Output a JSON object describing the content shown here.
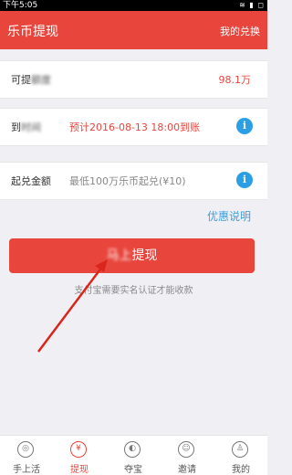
{
  "statusbar": {
    "time": "下午5:05",
    "icons": "≋ ▮ ◻"
  },
  "header": {
    "title": "乐币提现",
    "right_link": "我的兑换"
  },
  "rows": {
    "available": {
      "label": "可提",
      "blur_suffix": "额度",
      "value": "98.1万"
    },
    "arrival": {
      "label_prefix": "到",
      "label_suffix": "时间",
      "value": "预计2016-08-13 18:00到账",
      "info": "i"
    },
    "min_amount": {
      "label": "起兑金额",
      "value": "最低100万乐币起兑(¥10)",
      "info": "i"
    }
  },
  "promo_link": "优惠说明",
  "submit": {
    "label": "提现",
    "label_prefix": "马上"
  },
  "notice": "支付宝需要实名认证才能收款",
  "tabs": [
    {
      "label": "手上活",
      "icon": "◎"
    },
    {
      "label": "提现",
      "icon": "¥"
    },
    {
      "label": "夺宝",
      "icon": "◐"
    },
    {
      "label": "邀请",
      "icon": "☺"
    },
    {
      "label": "我的",
      "icon": "♙"
    }
  ],
  "colors": {
    "brand": "#e8453c",
    "link": "#3aa0e0",
    "info": "#2b9fe5"
  }
}
